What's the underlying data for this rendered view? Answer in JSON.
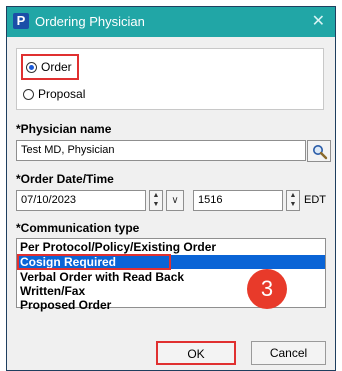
{
  "window": {
    "app_icon": "P",
    "title": "Ordering Physician",
    "close_glyph": "✕"
  },
  "order_type": {
    "options": [
      {
        "label": "Order",
        "selected": true
      },
      {
        "label": "Proposal",
        "selected": false
      }
    ]
  },
  "physician": {
    "label": "*Physician name",
    "value": "Test MD, Physician"
  },
  "order_datetime": {
    "label": "*Order Date/Time",
    "date": "07/10/2023",
    "time": "1516",
    "timezone": "EDT"
  },
  "communication": {
    "label": "*Communication type",
    "items": [
      "Per Protocol/Policy/Existing Order",
      "Cosign Required",
      "Verbal Order with Read Back",
      "Written/Fax",
      "Proposed Order"
    ],
    "selected_index": 1
  },
  "annotation": {
    "step_number": "3"
  },
  "buttons": {
    "ok": "OK",
    "cancel": "Cancel"
  },
  "colors": {
    "titlebar": "#21a6a6",
    "selection": "#0a64d6",
    "highlight": "#e03030",
    "badge": "#e83a2a"
  },
  "icons": {
    "app": "app-p-icon",
    "search": "search-icon",
    "close": "close-icon"
  }
}
